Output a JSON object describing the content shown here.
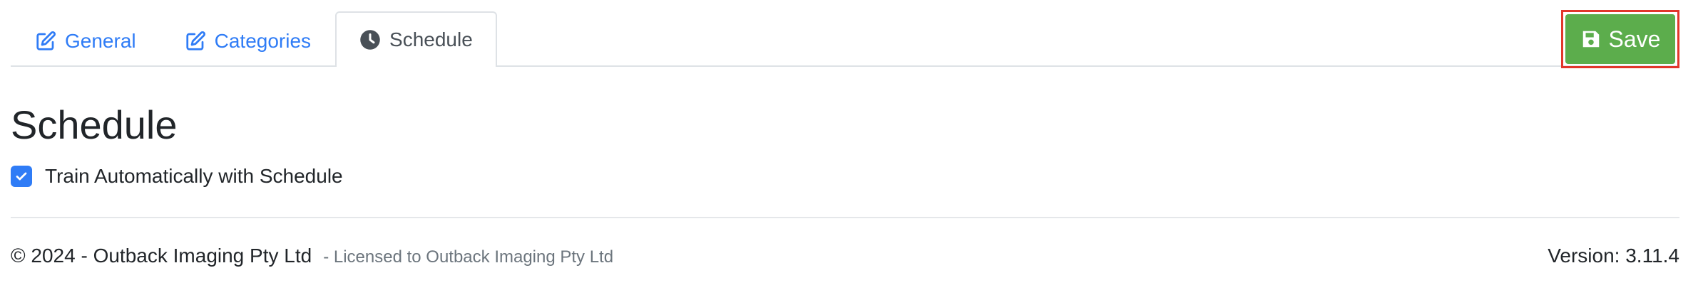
{
  "tabs": [
    {
      "label": "General",
      "icon": "edit-icon",
      "active": false
    },
    {
      "label": "Categories",
      "icon": "edit-icon",
      "active": false
    },
    {
      "label": "Schedule",
      "icon": "clock-icon",
      "active": true
    }
  ],
  "toolbar": {
    "save_label": "Save",
    "save_icon": "floppy-disk-icon"
  },
  "main": {
    "heading": "Schedule",
    "checkbox_label": "Train Automatically with Schedule",
    "checkbox_checked": true
  },
  "footer": {
    "copyright": "© 2024 - Outback Imaging Pty Ltd",
    "license": "- Licensed to Outback Imaging Pty Ltd",
    "version": "Version: 3.11.4"
  },
  "colors": {
    "link": "#2f7cf6",
    "save_bg": "#5cad4c",
    "highlight": "#e2362b"
  }
}
